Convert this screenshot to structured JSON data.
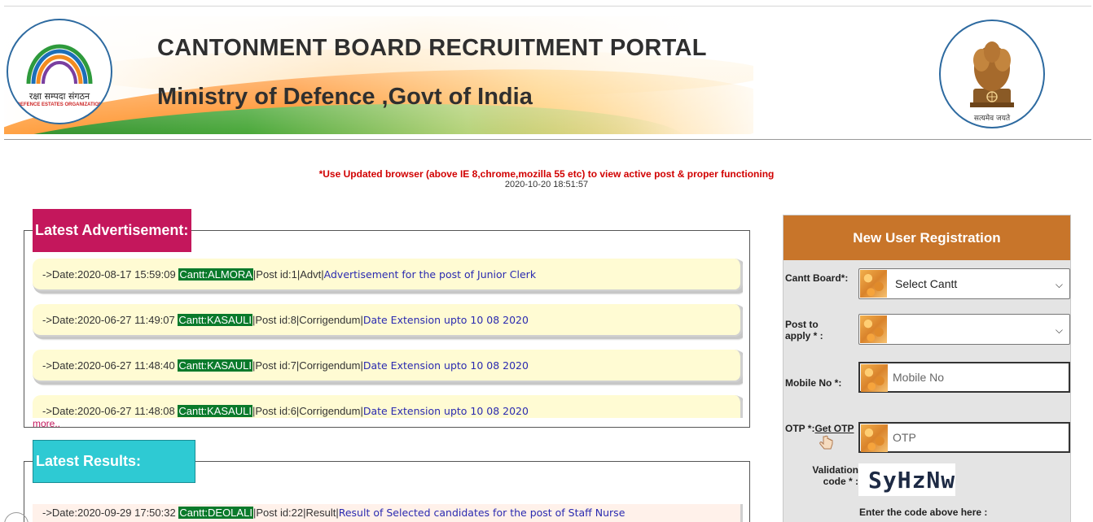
{
  "header": {
    "title": "CANTONMENT BOARD RECRUITMENT PORTAL",
    "subtitle": "Ministry of Defence ,Govt of India",
    "left_logo": {
      "icon": "dgde-logo-icon",
      "hindi": "रक्षा सम्पदा संगठन",
      "english": "DEFENCE ESTATES ORGANIZATION"
    },
    "right_logo": {
      "icon": "national-emblem-icon",
      "motto": "सत्यमेव जयते"
    }
  },
  "notice": {
    "warning": "*Use Updated browser (above IE 8,chrome,mozilla 55 etc) to view active post & proper functioning",
    "timestamp": "2020-10-20 18:51:57"
  },
  "advertisements": {
    "heading": "Latest Advertisement:",
    "more_label": "more..",
    "items": [
      {
        "date": "->Date:2020-08-17 15:59:09 ",
        "cantt": "Cantt:ALMORA",
        "mid": "|Post id:1|Advt|",
        "link": "Advertisement for the post of Junior Clerk"
      },
      {
        "date": "->Date:2020-06-27 11:49:07 ",
        "cantt": "Cantt:KASAULI",
        "mid": "|Post id:8|Corrigendum|",
        "link": "Date Extension upto 10 08 2020"
      },
      {
        "date": "->Date:2020-06-27 11:48:40 ",
        "cantt": "Cantt:KASAULI",
        "mid": "|Post id:7|Corrigendum|",
        "link": "Date Extension upto 10 08 2020"
      },
      {
        "date": "->Date:2020-06-27 11:48:08 ",
        "cantt": "Cantt:KASAULI",
        "mid": "|Post id:6|Corrigendum|",
        "link": "Date Extension upto 10 08 2020"
      }
    ]
  },
  "results": {
    "heading": "Latest Results:",
    "items": [
      {
        "date": "->Date:2020-09-29 17:50:32 ",
        "cantt": "Cantt:DEOLALI",
        "mid": "|Post id:22|Result|",
        "link": "Result of Selected candidates for the post of Staff Nurse"
      }
    ]
  },
  "registration": {
    "heading": "New User Registration",
    "cantt_label": "Cantt Board*:",
    "cantt_value": "Select Cantt",
    "post_label": "Post to apply * :",
    "post_value": "",
    "mobile_label": "Mobile No *:",
    "mobile_placeholder": "Mobile No",
    "otp_label": "OTP *:",
    "get_otp_label": "Get OTP",
    "otp_placeholder": "OTP",
    "validation_label": "Validation code * :",
    "captcha_text": "SyHzNw",
    "enter_code_label": "Enter the code above here :"
  },
  "colors": {
    "advert_legend": "#c4175c",
    "results_legend": "#2ecad3",
    "registration_header": "#c8752a",
    "cantt_badge": "#0a7a2b",
    "link": "#2a2ab0",
    "notice": "#d10000"
  }
}
